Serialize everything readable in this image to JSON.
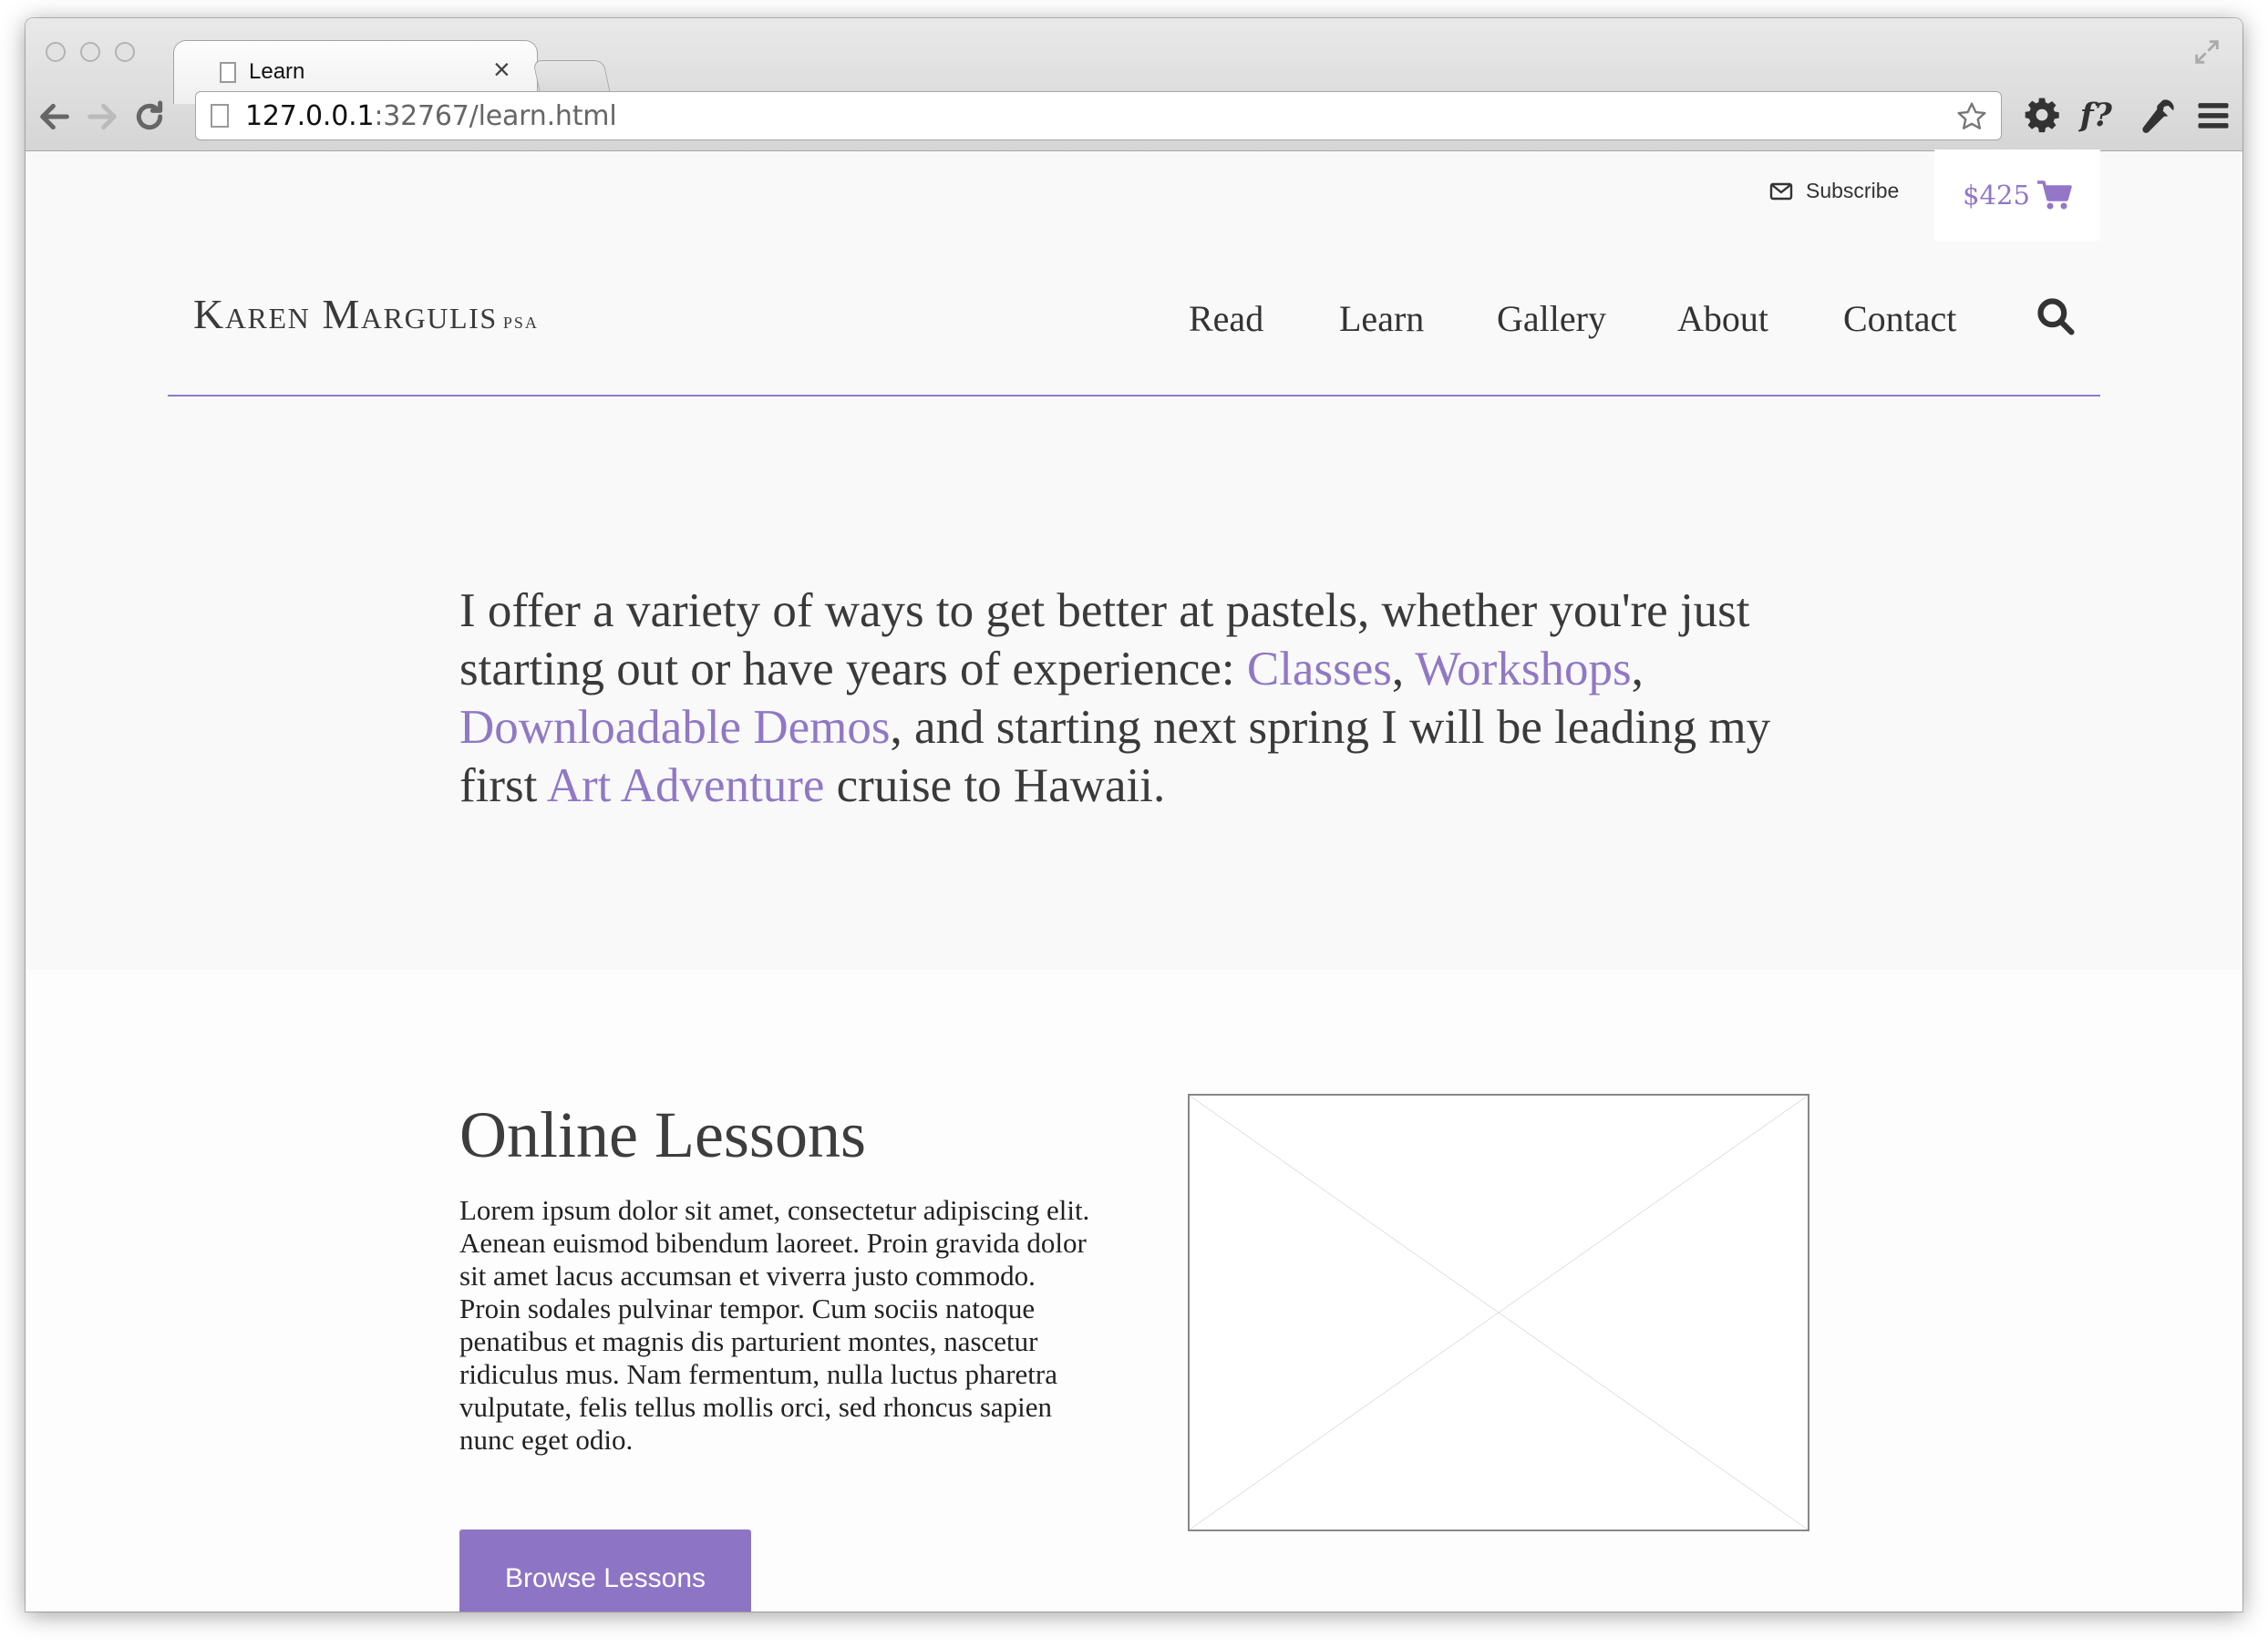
{
  "browser": {
    "tab_title": "Learn",
    "tab_close": "×",
    "url_host": "127.0.0.1",
    "url_rest": ":32767/learn.html"
  },
  "topbar": {
    "subscribe_label": "Subscribe",
    "cart_amount": "$425"
  },
  "logo": {
    "name": "Karen Margulis",
    "suffix": "psa"
  },
  "nav": {
    "items": [
      "Read",
      "Learn",
      "Gallery",
      "About",
      "Contact"
    ]
  },
  "intro": {
    "t1": "I offer a variety of ways to get better at pastels, whether you're just starting out or have years of experience: ",
    "link1": "Classes",
    "t2": ", ",
    "link2": "Workshops",
    "t3": ", ",
    "link3": "Downloadable Demos",
    "t4": ", and starting next spring I will be leading my first ",
    "link4": "Art Adventure",
    "t5": " cruise to Hawaii."
  },
  "lessons": {
    "title": "Online Lessons",
    "body": "Lorem ipsum dolor sit amet, consectetur adipiscing elit. Aenean euismod bibendum laoreet. Proin gravida dolor sit amet lacus accumsan et viverra justo commodo. Proin sodales pulvinar tempor. Cum sociis natoque penatibus et magnis dis parturient montes, nascetur ridiculus mus. Nam fermentum, nulla luctus pharetra vulputate, felis tellus mollis orci, sed rhoncus sapien nunc eget odio.",
    "button_label": "Browse Lessons"
  },
  "colors": {
    "accent": "#9078c5",
    "button": "#8e74c4",
    "text": "#3a3a3a"
  },
  "icons": [
    "page-icon",
    "close-icon",
    "fullscreen-icon",
    "back-arrow-icon",
    "forward-arrow-icon",
    "reload-icon",
    "star-icon",
    "gear-icon",
    "fontface-icon",
    "wrench-icon",
    "menu-icon",
    "envelope-icon",
    "cart-icon",
    "search-icon"
  ]
}
